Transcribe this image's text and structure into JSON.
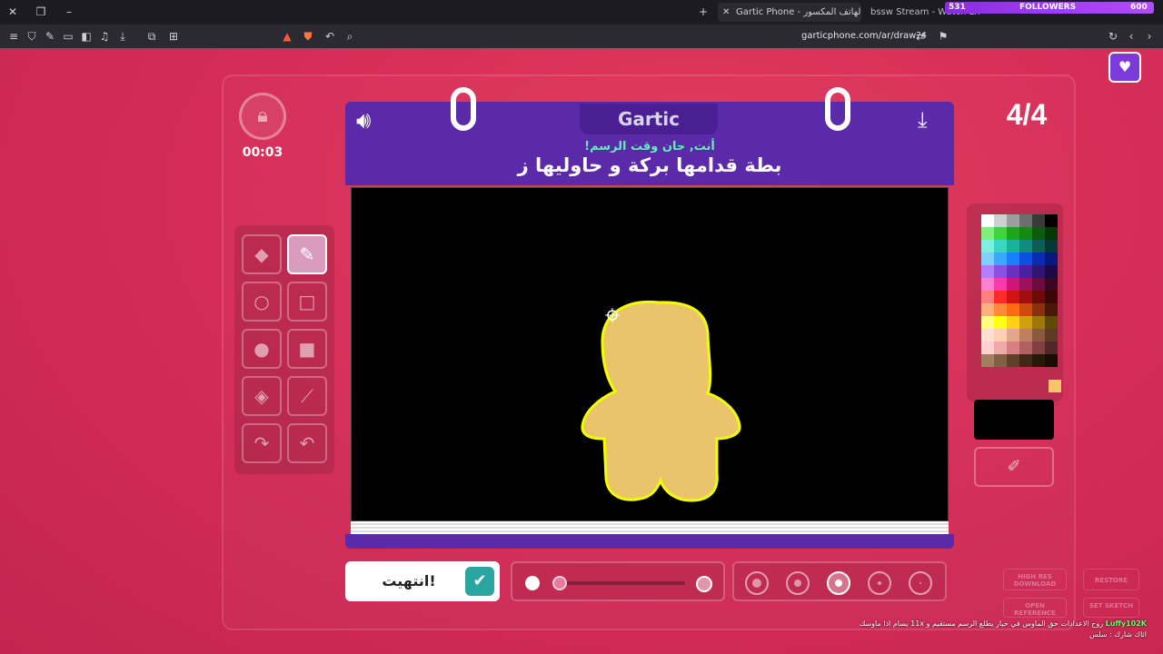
{
  "browser": {
    "active_tab_title": "Gartic Phone - لعبة الهاتف المكسور",
    "second_tab_title": "bssw Stream - Watch Live on Kick",
    "url": "garticphone.com/ar/draw?4",
    "followers_banner": {
      "label": "FOLLOWERS",
      "current": "531",
      "goal": "600"
    }
  },
  "game": {
    "logo": "Gartic",
    "timer": "00:03",
    "round": "4/4",
    "subtitle": "أنت, حان وقت الرسم!",
    "prompt": "بطة قدامها بركة و حاوليها ز",
    "done_label": "انتهيت!",
    "selected_color": "#f7c46a",
    "fill_color": "#e9c46a",
    "outline_color": "#f2ff00",
    "ghost_buttons": [
      "HIGH RES DOWNLOAD",
      "RESTORE",
      "OPEN REFERENCE",
      "SET SKETCH"
    ]
  },
  "palette": [
    "#ffffff",
    "#cfcfcf",
    "#9e9e9e",
    "#6e6e6e",
    "#3a3a3a",
    "#000000",
    "#7ef07e",
    "#3ed63e",
    "#1aa81a",
    "#138a13",
    "#0d5c0d",
    "#063806",
    "#7ff0e0",
    "#3ad6c4",
    "#19b0a0",
    "#138a80",
    "#0d5c58",
    "#063838",
    "#7fd0ff",
    "#3aa8ff",
    "#1a80ff",
    "#0d50e0",
    "#0a2ab0",
    "#061880",
    "#b080ff",
    "#8a50e0",
    "#6a30c0",
    "#4a20a0",
    "#301470",
    "#1c0a48",
    "#ff80d0",
    "#ff3aa8",
    "#d0147a",
    "#a00e5c",
    "#6e0a40",
    "#3a0620",
    "#ff8080",
    "#ff2a2a",
    "#d01414",
    "#a00e0e",
    "#6e0a0a",
    "#3a0606",
    "#ffb080",
    "#ff8a3a",
    "#ff6a14",
    "#d04a0e",
    "#8a300a",
    "#4a1806",
    "#ffff80",
    "#ffff14",
    "#ffd014",
    "#d0a00e",
    "#a0780a",
    "#604806",
    "#ffe0d0",
    "#ffd0b0",
    "#e0a888",
    "#c08060",
    "#8a5a40",
    "#5c3a24",
    "#ffd0d0",
    "#f0a8a8",
    "#d88080",
    "#b06060",
    "#804040",
    "#502828",
    "#a08060",
    "#806040",
    "#604028",
    "#402818",
    "#281808",
    "#180c04"
  ],
  "chat": {
    "user": "Luffy102K",
    "text": "روح الاعدادات حق الماوس في خيار يطلع الرسم مستقيم و 11x يسام اذا ماوسك اثاك شارك : سلس"
  }
}
